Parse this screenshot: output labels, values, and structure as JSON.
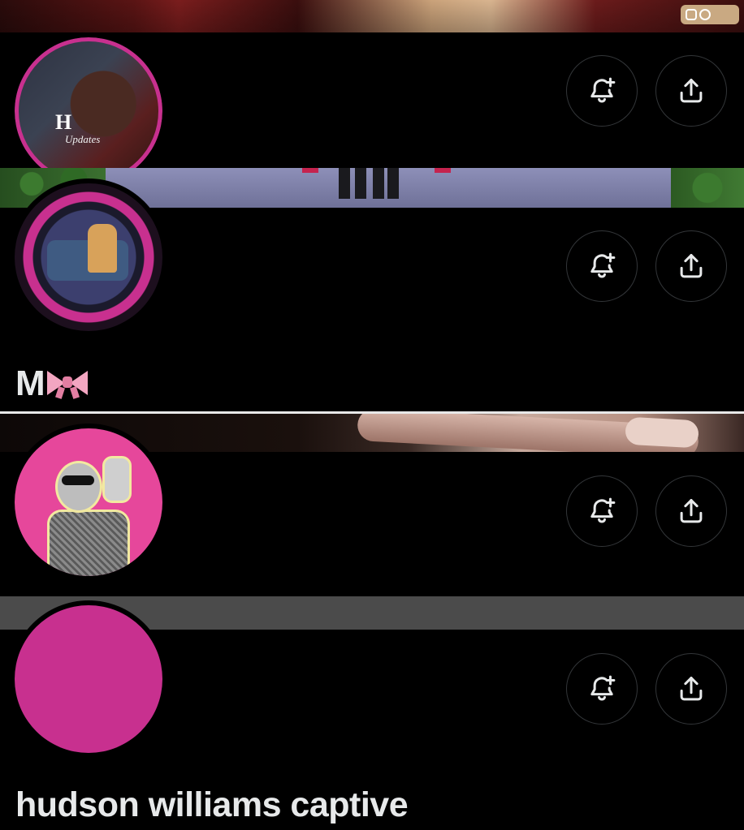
{
  "profiles": [
    {
      "banner": "red-curtain-portrait-banner",
      "banner_badge": "instagram-threads-watermark",
      "avatar": "hudson-updates-avatar",
      "avatar_text": "H",
      "avatar_subtext": "Updates",
      "name": "",
      "accent": "#c8308f"
    },
    {
      "banner": "sims-walkway-banner",
      "avatar": "sims-couple-pink-frame-avatar",
      "name": "M",
      "name_emoji": "ribbon-bow",
      "accent": "#c8308f"
    },
    {
      "banner": "hand-closeup-banner",
      "avatar": "masked-dancer-pink-avatar",
      "name": "",
      "accent": "#e6479b"
    },
    {
      "banner": "gray-banner",
      "avatar": "solid-pink-avatar",
      "name": "hudson williams captive",
      "accent": "#c8308f"
    }
  ],
  "actions": {
    "notify_icon": "bell-plus-icon",
    "share_icon": "share-upload-icon"
  },
  "colors": {
    "background": "#000000",
    "text": "#e7e9ea",
    "button_border": "#333639",
    "pink": "#c8308f"
  }
}
